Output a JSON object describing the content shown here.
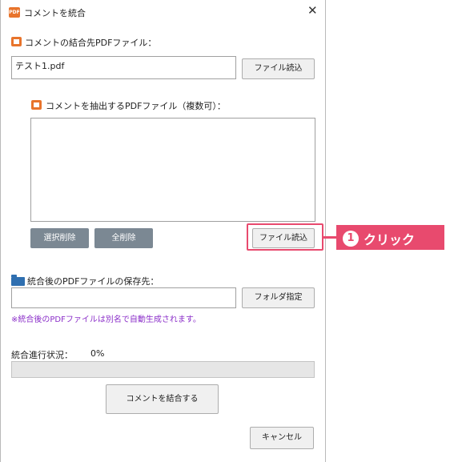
{
  "window": {
    "title": "コメントを統合",
    "close_glyph": "✕",
    "icon_text": "PDF"
  },
  "target": {
    "label": "コメントの結合先PDFファイル：",
    "value": "テスト1.pdf",
    "load_button": "ファイル読込"
  },
  "source": {
    "label": "コメントを抽出するPDFファイル（複数可）：",
    "items": [],
    "delete_selected": "選択削除",
    "delete_all": "全削除",
    "load_button": "ファイル読込"
  },
  "output": {
    "label": "統合後のPDFファイルの保存先：",
    "value": "",
    "folder_button": "フォルダ指定",
    "note": "※統合後のPDFファイルは別名で自動生成されます。"
  },
  "progress": {
    "label": "統合進行状況：",
    "percent_text": "0%",
    "value": 0
  },
  "actions": {
    "merge": "コメントを結合する",
    "cancel": "キャンセル"
  },
  "annotation": {
    "number": "1",
    "text": "クリック",
    "color": "#e84a6e"
  },
  "colors": {
    "accent": "#e84a6e",
    "note": "#8b2fc9",
    "gray_button": "#7b8893",
    "pdf_icon": "#e8742c",
    "folder_icon": "#2f6fb0"
  }
}
